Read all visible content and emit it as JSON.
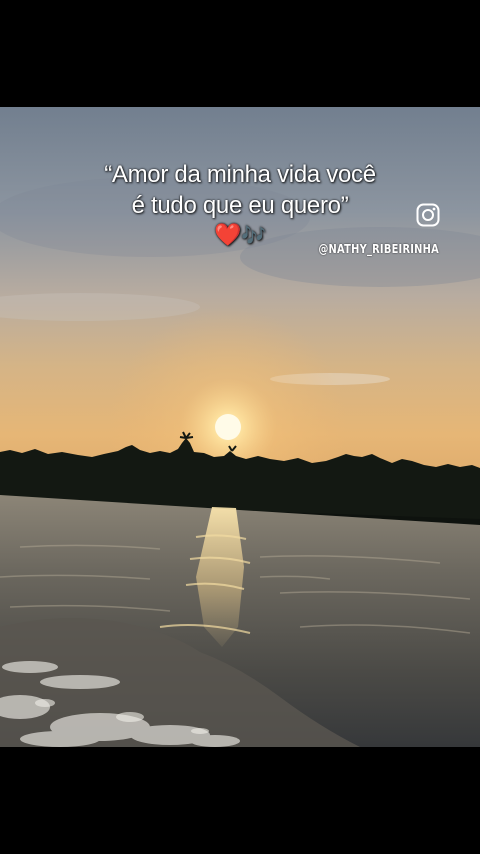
{
  "caption": {
    "line1": "“Amor da minha vida você",
    "line2": "é tudo que eu quero”",
    "heart": "❤️",
    "notes": "🎶"
  },
  "watermark": {
    "icon": "instagram-icon",
    "handle": "@NATHY_RIBEIRINHA"
  },
  "colors": {
    "letterbox": "#000000",
    "sky_top": "#7b8796",
    "sun": "#fff6d6",
    "horizon_glow": "#e9b36e",
    "treeline": "#111611",
    "water": "#5d5a52"
  }
}
